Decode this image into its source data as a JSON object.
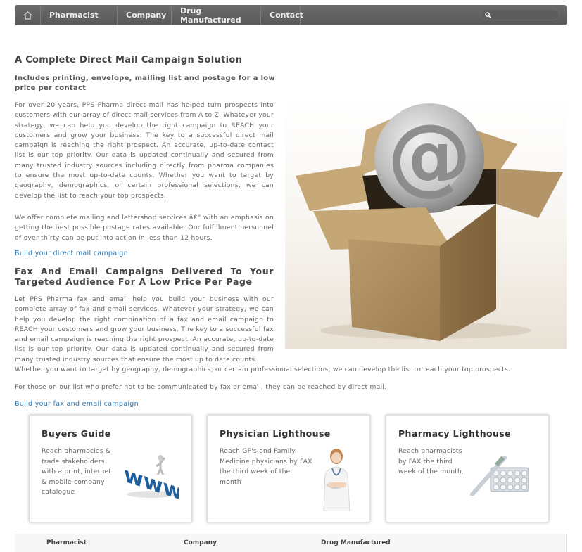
{
  "nav": {
    "items": [
      {
        "label": "Pharmacist"
      },
      {
        "label": "Company"
      },
      {
        "label": "Drug Manufactured"
      },
      {
        "label": "Contact"
      }
    ],
    "search_placeholder": ""
  },
  "section1": {
    "title": "A Complete Direct Mail Campaign Solution",
    "subtitle": "Includes printing, envelope, mailing list and postage for a low price per contact",
    "para1": "For over 20 years, PPS Pharma direct mail has helped turn prospects into customers with our array of direct mail services from A to Z. Whatever your strategy, we can help you develop the right campaign to REACH your customers and grow your business. The key to a successful direct mail campaign is reaching the right prospect. An accurate, up-to-date contact list is our top priority. Our data is updated continually and secured from many trusted industry sources including directly from pharma companies to ensure the most up-to-date counts. Whether you want to target by geography, demographics, or certain professional selections, we can develop the list to reach your top prospects.",
    "para2": "We offer complete mailing and lettershop services â€“ with an emphasis on getting the best possible postage rates available. Our fulfillment personnel of over thirty can be put into action in less than 12 hours.",
    "link": "Build your direct mail campaign"
  },
  "section2": {
    "title": "Fax And Email Campaigns Delivered To Your Targeted Audience For A Low Price Per Page",
    "para1": "Let PPS Pharma fax and email help you build your business with our complete array of fax and email services. Whatever your strategy, we can help you develop the right combination of a fax and email campaign to REACH your customers and grow your business. The key to a successful fax and email campaign is reaching the right prospect. An accurate, up-to-date list is our top priority. Our data is updated continually and secured from many trusted industry sources that ensure the most up to date counts.",
    "para1_tail": "Whether you want to target by geography, demographics, or certain professional selections, we can develop the list to reach your top prospects.",
    "para2": "For those on our list who prefer not to be communicated by fax or email, they can be reached by direct mail.",
    "link": "Build your fax and email campaign"
  },
  "cards": [
    {
      "title": "Buyers Guide",
      "lines": [
        "Reach pharmacies &",
        "trade stakeholders",
        "with a print, internet",
        "& mobile company",
        "catalogue"
      ]
    },
    {
      "title": "Physician Lighthouse",
      "lines": [
        "Reach GP's and Family",
        "Medicine physicians by FAX",
        "the third week of the",
        "month"
      ]
    },
    {
      "title": "Pharmacy Lighthouse",
      "lines": [
        "Reach pharmacists",
        "by FAX the third",
        "week of the month."
      ]
    }
  ],
  "footer": {
    "cols": [
      "Pharmacist",
      "Company",
      "Drug Manufactured"
    ]
  },
  "icons": {
    "home": "home-icon",
    "search": "search-icon"
  },
  "colors": {
    "nav_bg": "#5f5f5f",
    "link": "#2a78b5",
    "box": "#a8875a"
  }
}
